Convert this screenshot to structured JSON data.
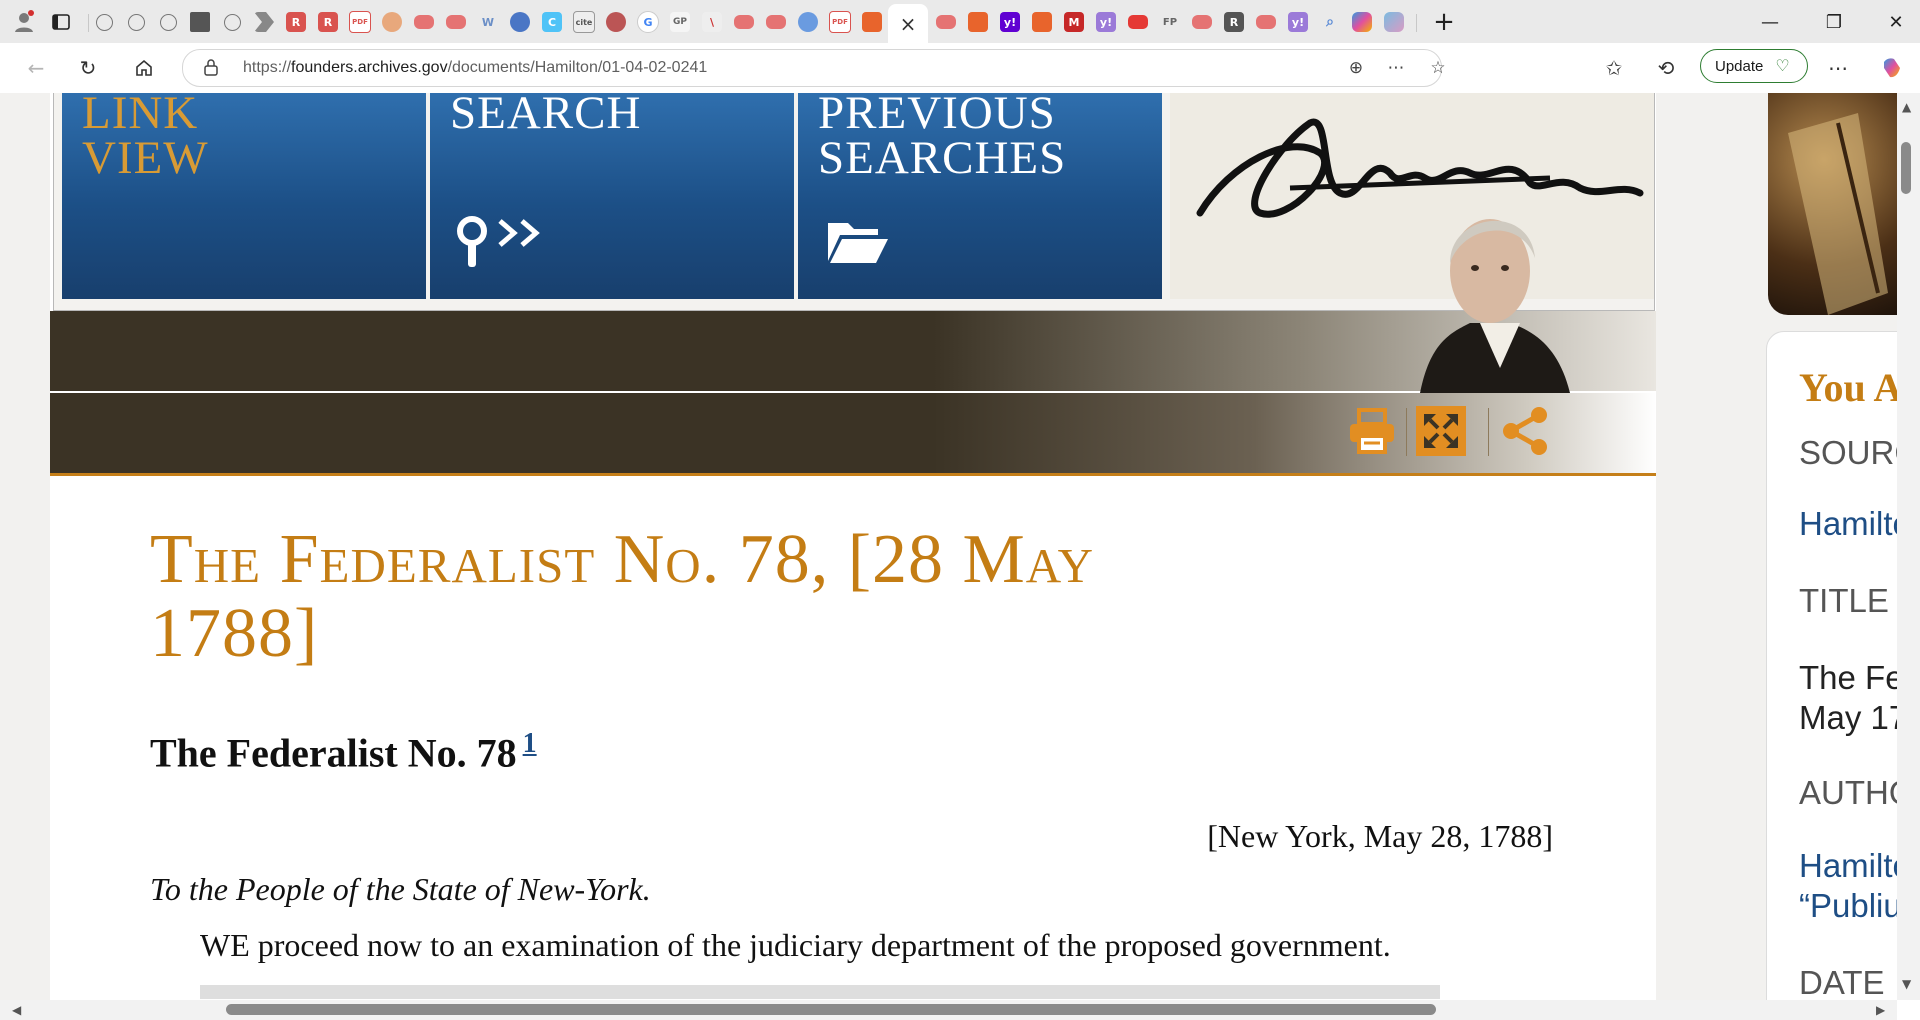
{
  "browser": {
    "address": {
      "url_prefix": "https://",
      "url_host": "founders.archives.gov",
      "url_path": "/documents/Hamilton/01-04-02-0241"
    },
    "update_label": "Update",
    "new_tab_glyph": "+",
    "tab_close_glyph": "×",
    "window_controls": {
      "minimize": "—",
      "maximize": "❐",
      "close": "✕"
    },
    "tab_icon_labels": [
      "W",
      "G",
      "GP",
      "FP",
      "y!",
      "M"
    ]
  },
  "site": {
    "nav_tiles": [
      {
        "label_line1": "LINK",
        "label_line2": "VIEW"
      },
      {
        "label_line1": "SEARCH",
        "label_line2": ""
      },
      {
        "label_line1": "PREVIOUS",
        "label_line2": "SEARCHES"
      }
    ]
  },
  "document": {
    "title_line1": "The Federalist No. 78, [28 May",
    "title_line2": "1788]",
    "subtitle": "The Federalist No. 78",
    "footnote_ref": "1",
    "dateline": "[New York, May 28, 1788]",
    "salutation": "To the People of the State of New-York.",
    "first_paragraph": "WE proceed now to an examination of the judiciary department of the proposed government."
  },
  "sidebar": {
    "heading": "You A",
    "source_label": "SOURC",
    "source_value": "Hamilto",
    "title_label": "TITLE",
    "title_value_line1": "The Fe",
    "title_value_line2": "May 17",
    "author_label": "AUTHO",
    "author_value_line1": "Hamilto",
    "author_value_line2": "“Publiu",
    "date_label": "DATE"
  },
  "colors": {
    "accent_gold": "#c47d14",
    "nav_blue": "#1c4f86",
    "band_brown": "#3b3325",
    "link_blue": "#1e4e85"
  }
}
